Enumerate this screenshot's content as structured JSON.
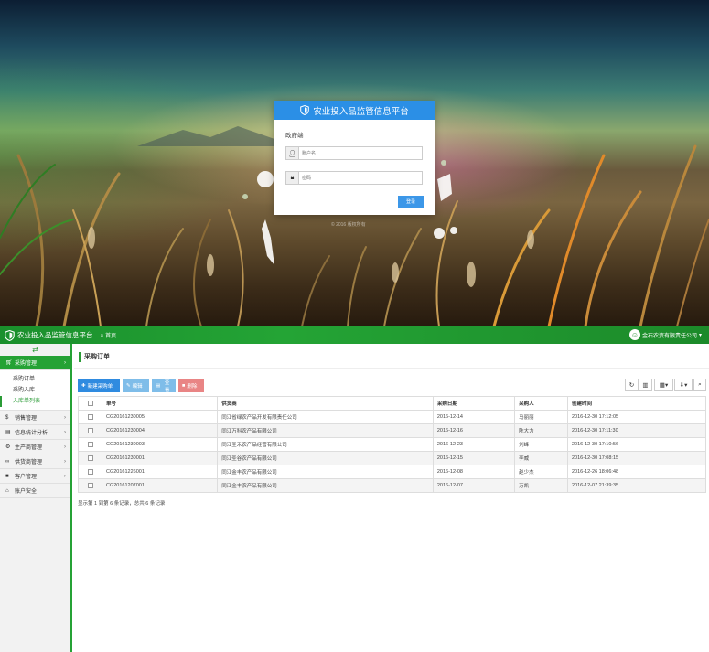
{
  "login": {
    "platform_title": "农业投入品监管信息平台",
    "role_label": "政府端",
    "username_placeholder": "账户名",
    "password_placeholder": "密码",
    "submit_label": "登录",
    "copyright": "© 2016 版权所有"
  },
  "app": {
    "title": "农业投入品监管信息平台",
    "home_label": "首页",
    "user_label": "金石农资有限责任公司",
    "colors": {
      "header": "#24a435",
      "accent": "#2a9b36",
      "primary_btn": "#2f8be0",
      "danger_btn": "#e98585"
    }
  },
  "sidebar": {
    "items": [
      {
        "icon": "cart-icon",
        "label": "采购管理",
        "active": true,
        "children": [
          "采购订单",
          "采购入库",
          "入库单列表"
        ],
        "current_child": 2
      },
      {
        "icon": "dollar-icon",
        "label": "销售管理"
      },
      {
        "icon": "chart-icon",
        "label": "信息统计分析"
      },
      {
        "icon": "gear-icon",
        "label": "生产商管理"
      },
      {
        "icon": "link-icon",
        "label": "供货商管理"
      },
      {
        "icon": "user-icon",
        "label": "客户管理"
      },
      {
        "icon": "home-icon",
        "label": "账户安全"
      }
    ]
  },
  "main": {
    "page_title": "采购订单",
    "toolbar": {
      "new_label": "新建采购单",
      "edit_label": "编辑",
      "view_label": "查看",
      "delete_label": "删除"
    },
    "table": {
      "columns": [
        "单号",
        "供货商",
        "采购日期",
        "采购人",
        "创建时间"
      ],
      "rows": [
        [
          "CG20161230005",
          "同江省绿农产品开发有限责任公司",
          "2016-12-14",
          "马丽丽",
          "2016-12-30 17:12:05"
        ],
        [
          "CG20161230004",
          "同江万科农产品有限公司",
          "2016-12-16",
          "陈大力",
          "2016-12-30 17:11:30"
        ],
        [
          "CG20161230003",
          "同江圣禾农产品经营有限公司",
          "2016-12-23",
          "刘峰",
          "2016-12-30 17:10:56"
        ],
        [
          "CG20161230001",
          "同江圣谷农产品有限公司",
          "2016-12-15",
          "李威",
          "2016-12-30 17:08:15"
        ],
        [
          "CG20161226001",
          "同江金丰农产品有限公司",
          "2016-12-08",
          "赵少杰",
          "2016-12-26 18:06:48"
        ],
        [
          "CG20161207001",
          "同江金丰农产品有限公司",
          "2016-12-07",
          "万凯",
          "2016-12-07 21:39:35"
        ]
      ]
    },
    "pagination_text": "显示第 1 到第 6 条记录，总共 6 条记录"
  }
}
